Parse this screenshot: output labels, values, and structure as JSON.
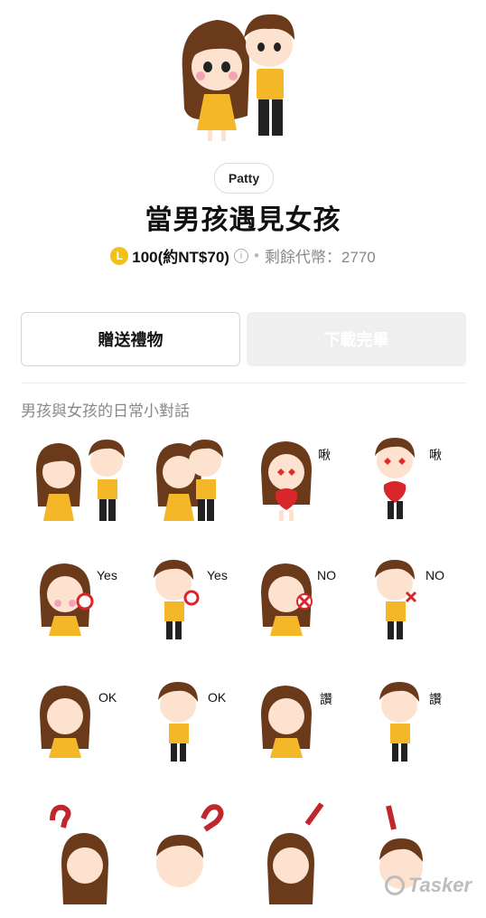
{
  "author": "Patty",
  "title": "當男孩遇見女孩",
  "price": {
    "coin_glyph": "L",
    "amount": "100(約NT$70)",
    "info_glyph": "i",
    "balance": "剩餘代幣：2770"
  },
  "buttons": {
    "gift": "贈送禮物",
    "download": "下載完畢"
  },
  "description": "男孩與女孩的日常小對話",
  "sticker_labels": {
    "s3": "啾",
    "s4": "啾",
    "s5": "Yes",
    "s6": "Yes",
    "s7": "NO",
    "s8": "NO",
    "s9": "OK",
    "s10": "OK",
    "s11": "讚",
    "s12": "讚"
  },
  "watermark": "Tasker",
  "colors": {
    "coin": "#f2c21b",
    "girl_hair": "#6b3a1a",
    "shirt": "#f3b728"
  }
}
